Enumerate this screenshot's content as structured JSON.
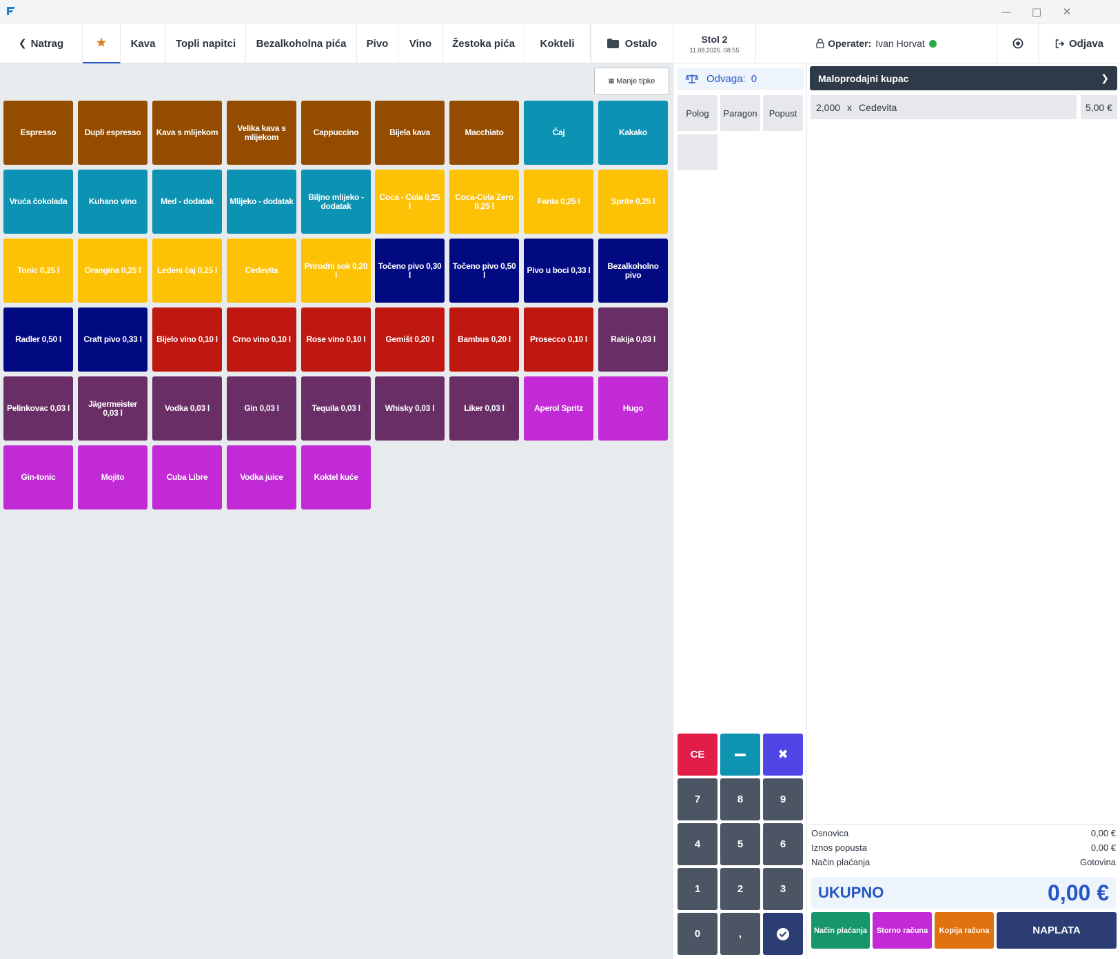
{
  "titlebar": {
    "minimize_icon": "minimize-icon",
    "maximize_icon": "maximize-icon",
    "close_icon": "close-icon"
  },
  "nav": {
    "back_label": "Natrag",
    "favorites_icon": "star-icon",
    "tabs": [
      "Kava",
      "Topli napitci",
      "Bezalkoholna pića",
      "Pivo",
      "Vino",
      "Žestoka pića",
      "Kokteli"
    ],
    "other_label": "Ostalo",
    "table_name": "Stol 2",
    "table_time": "11.08.2026. 08:55",
    "operator_label": "Operater:",
    "operator_name": "Ivan Horvat",
    "logout_label": "Odjava"
  },
  "products": {
    "less_keys_label": "Manje tipke",
    "items": [
      {
        "label": "Espresso",
        "color": "#944c00"
      },
      {
        "label": "Dupli espresso",
        "color": "#944c00"
      },
      {
        "label": "Kava s mlijekom",
        "color": "#944c00"
      },
      {
        "label": "Velika kava s mlijekom",
        "color": "#944c00"
      },
      {
        "label": "Cappuccino",
        "color": "#944c00"
      },
      {
        "label": "Bijela kava",
        "color": "#944c00"
      },
      {
        "label": "Macchiato",
        "color": "#944c00"
      },
      {
        "label": "Čaj",
        "color": "#0c93b3"
      },
      {
        "label": "Kakako",
        "color": "#0c93b3"
      },
      {
        "label": "Vruća čokolada",
        "color": "#0c93b3"
      },
      {
        "label": "Kuhano vino",
        "color": "#0c93b3"
      },
      {
        "label": "Med - dodatak",
        "color": "#0c93b3"
      },
      {
        "label": "Mlijeko - dodatak",
        "color": "#0c93b3"
      },
      {
        "label": "Biljno mlijeko - dodatak",
        "color": "#0c93b3"
      },
      {
        "label": "Coca - Cola 0,25 l",
        "color": "#fdc106"
      },
      {
        "label": "Coca-Cola Zero 0,25 l",
        "color": "#fdc106"
      },
      {
        "label": "Fanta 0,25 l",
        "color": "#fdc106"
      },
      {
        "label": "Sprite 0,25 l",
        "color": "#fdc106"
      },
      {
        "label": "Tonic 0,25 l",
        "color": "#fdc106"
      },
      {
        "label": "Orangina 0,25 l",
        "color": "#fdc106"
      },
      {
        "label": "Ledeni čaj 0,25 l",
        "color": "#fdc106"
      },
      {
        "label": "Cedevita",
        "color": "#fdc106"
      },
      {
        "label": "Prirodni sok 0,20 l",
        "color": "#fdc106"
      },
      {
        "label": "Točeno pivo 0,30 l",
        "color": "#020a82"
      },
      {
        "label": "Točeno pivo 0,50 l",
        "color": "#020a82"
      },
      {
        "label": "Pivo u boci 0,33 l",
        "color": "#020a82"
      },
      {
        "label": "Bezalkoholno pivo",
        "color": "#020a82"
      },
      {
        "label": "Radler 0,50 l",
        "color": "#020a82"
      },
      {
        "label": "Craft pivo 0,33 l",
        "color": "#020a82"
      },
      {
        "label": "Bijelo vino 0,10 l",
        "color": "#be1810"
      },
      {
        "label": "Crno vino 0,10 l",
        "color": "#be1810"
      },
      {
        "label": "Rose vino 0,10 l",
        "color": "#be1810"
      },
      {
        "label": "Gemišt 0,20 l",
        "color": "#be1810"
      },
      {
        "label": "Bambus 0,20 l",
        "color": "#be1810"
      },
      {
        "label": "Prosecco 0,10 l",
        "color": "#be1810"
      },
      {
        "label": "Rakija 0,03 l",
        "color": "#6a2e66"
      },
      {
        "label": "Pelinkovac 0,03 l",
        "color": "#6a2e66"
      },
      {
        "label": "Jägermeister 0,03 l",
        "color": "#6a2e66"
      },
      {
        "label": "Vodka 0,03 l",
        "color": "#6a2e66"
      },
      {
        "label": "Gin 0,03 l",
        "color": "#6a2e66"
      },
      {
        "label": "Tequila 0,03 l",
        "color": "#6a2e66"
      },
      {
        "label": "Whisky 0,03 l",
        "color": "#6a2e66"
      },
      {
        "label": "Liker 0,03 l",
        "color": "#6a2e66"
      },
      {
        "label": "Aperol Spritz",
        "color": "#c12ad4"
      },
      {
        "label": "Hugo",
        "color": "#c12ad4"
      },
      {
        "label": "Gin-tonic",
        "color": "#c12ad4"
      },
      {
        "label": "Mojito",
        "color": "#c12ad4"
      },
      {
        "label": "Cuba Libre",
        "color": "#c12ad4"
      },
      {
        "label": "Vodka juice",
        "color": "#c12ad4"
      },
      {
        "label": "Koktel kuće",
        "color": "#c12ad4"
      }
    ]
  },
  "scale": {
    "label": "Odvaga:",
    "value": "0",
    "icon": "scale-icon"
  },
  "utility_buttons": [
    "Polog",
    "Paragon",
    "Popust"
  ],
  "keypad": {
    "ce": "CE",
    "digits": [
      "7",
      "8",
      "9",
      "4",
      "5",
      "6",
      "1",
      "2",
      "3",
      "0",
      ","
    ],
    "minus_icon": "minus-icon",
    "multiply_icon": "times-icon",
    "confirm_icon": "check-circle-icon"
  },
  "receipt": {
    "customer": "Maloprodajni kupac",
    "lines": [
      {
        "quantity": "2,000",
        "sep": "x",
        "name": "Cedevita",
        "price": "5,00 €"
      }
    ],
    "summary": {
      "base_label": "Osnovica",
      "base_value": "0,00 €",
      "discount_label": "Iznos popusta",
      "discount_value": "0,00 €",
      "payment_label": "Način plaćanja",
      "payment_value": "Gotovina"
    },
    "total_label": "UKUPNO",
    "total_value": "0,00 €"
  },
  "actions": {
    "payment_method": "Način plaćanja",
    "cancel_receipt": "Storno računa",
    "copy_receipt": "Kopija računa",
    "checkout": "NAPLATA"
  },
  "colors": {
    "accent": "#2556c4",
    "coffee": "#944c00",
    "hot_drinks": "#0c93b3",
    "soft_drinks": "#fdc106",
    "beer": "#020a82",
    "wine": "#be1810",
    "spirits": "#6a2e66",
    "cocktails": "#c12ad4",
    "payment_method_btn": "#17956b",
    "cancel_btn": "#c12ad4",
    "copy_btn": "#e0720f",
    "checkout_btn": "#2b3d73",
    "status_online": "#27a844"
  }
}
